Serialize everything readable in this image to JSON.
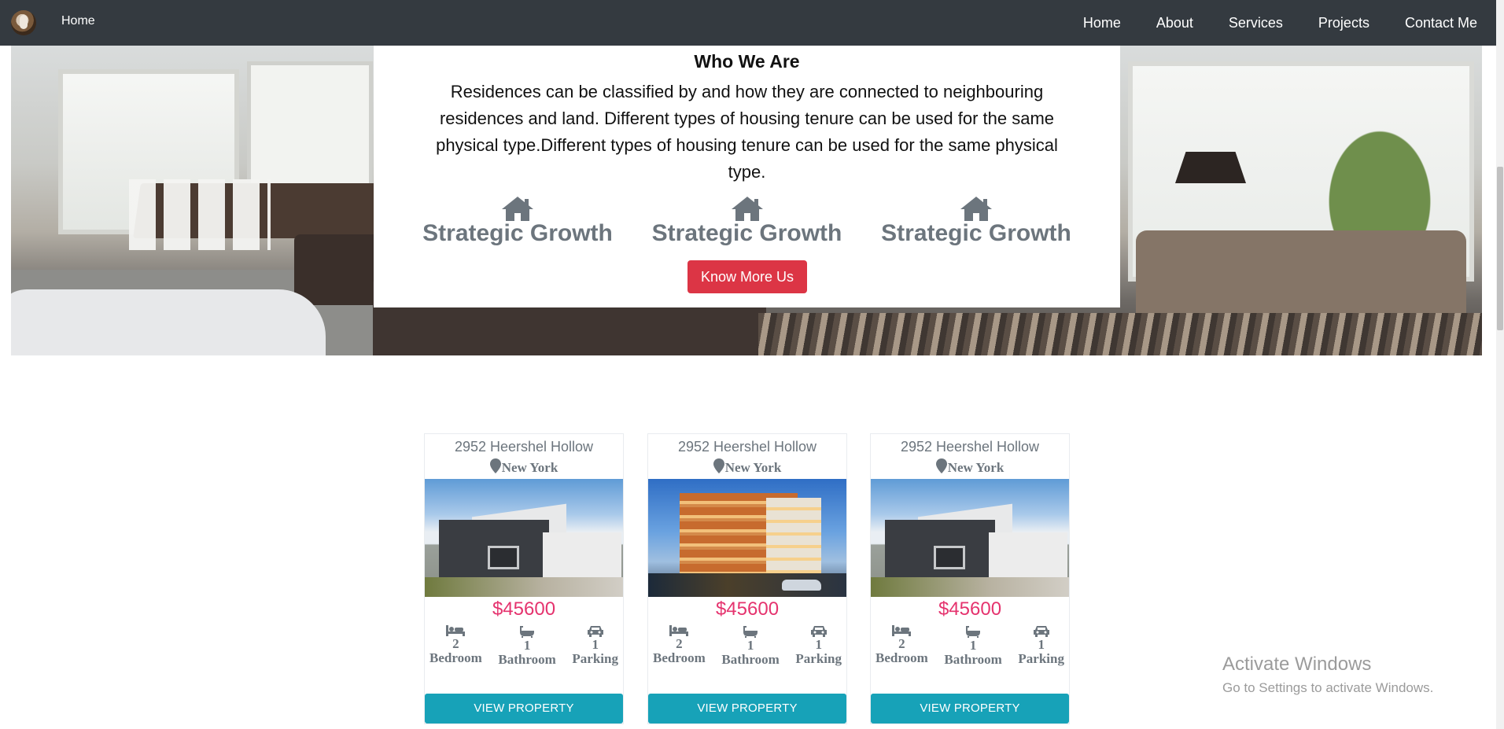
{
  "navbar": {
    "brand_link": "Home",
    "links": [
      "Home",
      "About",
      "Services",
      "Projects",
      "Contact Me"
    ]
  },
  "about": {
    "title": "Who We Are",
    "text": "Residences can be classified by and how they are connected to neighbouring residences and land. Different types of housing tenure can be used for the same physical type.Different types of housing tenure can be used for the same physical type.",
    "features": [
      {
        "icon": "home-icon",
        "label": "Strategic Growth"
      },
      {
        "icon": "home-icon",
        "label": "Strategic Growth"
      },
      {
        "icon": "home-icon",
        "label": "Strategic Growth"
      }
    ],
    "button_label": "Know More Us"
  },
  "properties": [
    {
      "address": "2952 Heershel Hollow",
      "city": "New York",
      "image": "house-photo",
      "price": "$45600",
      "amenities": [
        {
          "icon": "bed-icon",
          "count": "2",
          "label": "Bedroom"
        },
        {
          "icon": "bath-icon",
          "count": "1",
          "label": "Bathroom"
        },
        {
          "icon": "car-icon",
          "count": "1",
          "label": "Parking"
        }
      ],
      "button_label": "VIEW PROPERTY"
    },
    {
      "address": "2952 Heershel Hollow",
      "city": "New York",
      "image": "apartment-building-photo",
      "price": "$45600",
      "amenities": [
        {
          "icon": "bed-icon",
          "count": "2",
          "label": "Bedroom"
        },
        {
          "icon": "bath-icon",
          "count": "1",
          "label": "Bathroom"
        },
        {
          "icon": "car-icon",
          "count": "1",
          "label": "Parking"
        }
      ],
      "button_label": "VIEW PROPERTY"
    },
    {
      "address": "2952 Heershel Hollow",
      "city": "New York",
      "image": "house-photo",
      "price": "$45600",
      "amenities": [
        {
          "icon": "bed-icon",
          "count": "2",
          "label": "Bedroom"
        },
        {
          "icon": "bath-icon",
          "count": "1",
          "label": "Bathroom"
        },
        {
          "icon": "car-icon",
          "count": "1",
          "label": "Parking"
        }
      ],
      "button_label": "VIEW PROPERTY"
    }
  ],
  "watermark": {
    "title": "Activate Windows",
    "subtitle": "Go to Settings to activate Windows."
  },
  "colors": {
    "navbar": "#343a40",
    "accent_red": "#dc3545",
    "price": "#e5336e",
    "button_teal": "#17a2b8",
    "muted_text": "#6c757d"
  }
}
